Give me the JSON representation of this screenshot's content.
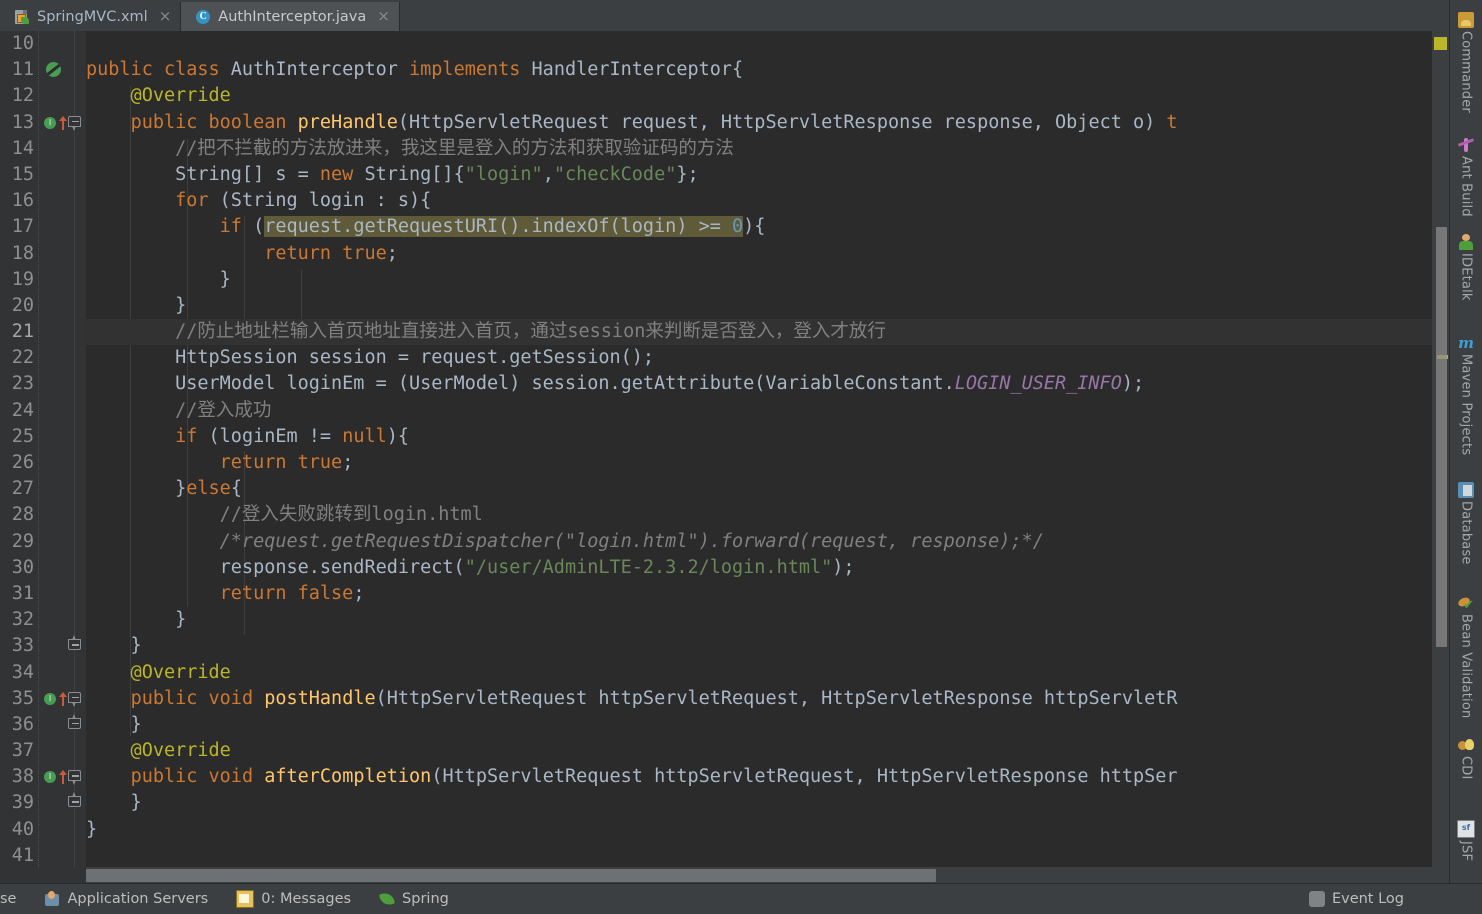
{
  "window": {
    "theme": "Darcula",
    "colors": {
      "editor_bg": "#2b2b2b",
      "gutter_bg": "#313335",
      "panel_bg": "#3c3f41",
      "active_tab_bg": "#4e5254",
      "text": "#a9b7c6",
      "keyword": "#cc7832",
      "string": "#6a8759",
      "comment": "#808080",
      "annotation": "#bbb529",
      "method": "#ffc66d",
      "number": "#6897bb",
      "static_field": "#9876aa",
      "selection": "#5f5a37",
      "current_line": "#323232",
      "marker_warning": "#bbb529"
    }
  },
  "tabs": [
    {
      "label": "SpringMVC.xml",
      "icon": "xml-file-icon",
      "active": false,
      "close": "×"
    },
    {
      "label": "AuthInterceptor.java",
      "icon": "java-class-icon",
      "active": true,
      "close": "×"
    }
  ],
  "editor": {
    "file": "AuthInterceptor.java",
    "first_visible_line": 10,
    "last_visible_line": 41,
    "current_line": 21,
    "lines": [
      {
        "n": "10",
        "tokens": []
      },
      {
        "n": "11",
        "marker": "run",
        "fold": null,
        "tokens": [
          {
            "t": "public ",
            "c": "kw"
          },
          {
            "t": "class ",
            "c": "kw"
          },
          {
            "t": "AuthInterceptor ",
            "c": "cls"
          },
          {
            "t": "implements ",
            "c": "kw"
          },
          {
            "t": "HandlerInterceptor{",
            "c": "plain"
          }
        ]
      },
      {
        "n": "12",
        "tokens": [
          {
            "t": "    @Override",
            "c": "ann"
          }
        ]
      },
      {
        "n": "13",
        "marker": "impl",
        "fold": "start",
        "tokens": [
          {
            "t": "    ",
            "c": "plain"
          },
          {
            "t": "public ",
            "c": "kw"
          },
          {
            "t": "boolean ",
            "c": "kw"
          },
          {
            "t": "preHandle",
            "c": "mth"
          },
          {
            "t": "(HttpServletRequest request, HttpServletResponse response, Object o) ",
            "c": "plain"
          },
          {
            "t": "t",
            "c": "kw"
          }
        ]
      },
      {
        "n": "14",
        "tokens": [
          {
            "t": "        //把不拦截的方法放进来，我这里是登入的方法和获取验证码的方法",
            "c": "cmt"
          }
        ]
      },
      {
        "n": "15",
        "tokens": [
          {
            "t": "        String[] s = ",
            "c": "plain"
          },
          {
            "t": "new ",
            "c": "kw"
          },
          {
            "t": "String[]{",
            "c": "plain"
          },
          {
            "t": "\"login\"",
            "c": "str"
          },
          {
            "t": ",",
            "c": "plain"
          },
          {
            "t": "\"checkCode\"",
            "c": "str"
          },
          {
            "t": "};",
            "c": "plain"
          }
        ]
      },
      {
        "n": "16",
        "tokens": [
          {
            "t": "        ",
            "c": "plain"
          },
          {
            "t": "for ",
            "c": "kw"
          },
          {
            "t": "(String login : s){",
            "c": "plain"
          }
        ]
      },
      {
        "n": "17",
        "tokens": [
          {
            "t": "            ",
            "c": "plain"
          },
          {
            "t": "if ",
            "c": "kw"
          },
          {
            "t": "(",
            "c": "plain"
          },
          {
            "t": "request.getRequestURI().indexOf(login) >= ",
            "c": "plain sel"
          },
          {
            "t": "0",
            "c": "num2 sel"
          },
          {
            "t": "){",
            "c": "plain"
          }
        ]
      },
      {
        "n": "18",
        "tokens": [
          {
            "t": "                ",
            "c": "plain"
          },
          {
            "t": "return ",
            "c": "kw"
          },
          {
            "t": "true",
            "c": "kw"
          },
          {
            "t": ";",
            "c": "plain"
          }
        ]
      },
      {
        "n": "19",
        "tokens": [
          {
            "t": "            }",
            "c": "plain"
          }
        ]
      },
      {
        "n": "20",
        "tokens": [
          {
            "t": "        }",
            "c": "plain"
          }
        ]
      },
      {
        "n": "21",
        "current": true,
        "tokens": [
          {
            "t": "        //防止地址栏输入首页地址直接进入首页，通过session来判断是否登入，登入才放行",
            "c": "cmt"
          }
        ]
      },
      {
        "n": "22",
        "tokens": [
          {
            "t": "        HttpSession session = request.getSession();",
            "c": "plain"
          }
        ]
      },
      {
        "n": "23",
        "tokens": [
          {
            "t": "        UserModel loginEm = (UserModel) session.getAttribute(VariableConstant.",
            "c": "plain"
          },
          {
            "t": "LOGIN_USER_INFO",
            "c": "stat"
          },
          {
            "t": ");",
            "c": "plain"
          }
        ]
      },
      {
        "n": "24",
        "tokens": [
          {
            "t": "        //登入成功",
            "c": "cmt"
          }
        ]
      },
      {
        "n": "25",
        "tokens": [
          {
            "t": "        ",
            "c": "plain"
          },
          {
            "t": "if ",
            "c": "kw"
          },
          {
            "t": "(loginEm != ",
            "c": "plain"
          },
          {
            "t": "null",
            "c": "kw"
          },
          {
            "t": "){",
            "c": "plain"
          }
        ]
      },
      {
        "n": "26",
        "tokens": [
          {
            "t": "            ",
            "c": "plain"
          },
          {
            "t": "return ",
            "c": "kw"
          },
          {
            "t": "true",
            "c": "kw"
          },
          {
            "t": ";",
            "c": "plain"
          }
        ]
      },
      {
        "n": "27",
        "tokens": [
          {
            "t": "        }",
            "c": "plain"
          },
          {
            "t": "else",
            "c": "kw"
          },
          {
            "t": "{",
            "c": "plain"
          }
        ]
      },
      {
        "n": "28",
        "tokens": [
          {
            "t": "            //登入失败跳转到login.html",
            "c": "cmt"
          }
        ]
      },
      {
        "n": "29",
        "tokens": [
          {
            "t": "            /*request.getRequestDispatcher(\"login.html\").forward(request, response);*/",
            "c": "cmt-i"
          }
        ]
      },
      {
        "n": "30",
        "tokens": [
          {
            "t": "            response.sendRedirect(",
            "c": "plain"
          },
          {
            "t": "\"/user/AdminLTE-2.3.2/login.html\"",
            "c": "str"
          },
          {
            "t": ");",
            "c": "plain"
          }
        ]
      },
      {
        "n": "31",
        "tokens": [
          {
            "t": "            ",
            "c": "plain"
          },
          {
            "t": "return ",
            "c": "kw"
          },
          {
            "t": "false",
            "c": "kw"
          },
          {
            "t": ";",
            "c": "plain"
          }
        ]
      },
      {
        "n": "32",
        "tokens": [
          {
            "t": "        }",
            "c": "plain"
          }
        ]
      },
      {
        "n": "33",
        "fold": "end",
        "tokens": [
          {
            "t": "    }",
            "c": "plain"
          }
        ]
      },
      {
        "n": "34",
        "tokens": [
          {
            "t": "    @Override",
            "c": "ann"
          }
        ]
      },
      {
        "n": "35",
        "marker": "impl",
        "fold": "start",
        "tokens": [
          {
            "t": "    ",
            "c": "plain"
          },
          {
            "t": "public ",
            "c": "kw"
          },
          {
            "t": "void ",
            "c": "kw"
          },
          {
            "t": "postHandle",
            "c": "mth"
          },
          {
            "t": "(HttpServletRequest httpServletRequest, HttpServletResponse httpServletR",
            "c": "plain"
          }
        ]
      },
      {
        "n": "36",
        "fold": "end",
        "tokens": [
          {
            "t": "    }",
            "c": "plain"
          }
        ]
      },
      {
        "n": "37",
        "tokens": [
          {
            "t": "    @Override",
            "c": "ann"
          }
        ]
      },
      {
        "n": "38",
        "marker": "impl",
        "fold": "start",
        "tokens": [
          {
            "t": "    ",
            "c": "plain"
          },
          {
            "t": "public ",
            "c": "kw"
          },
          {
            "t": "void ",
            "c": "kw"
          },
          {
            "t": "afterCompletion",
            "c": "mth"
          },
          {
            "t": "(HttpServletRequest httpServletRequest, HttpServletResponse httpSer",
            "c": "plain"
          }
        ]
      },
      {
        "n": "39",
        "fold": "end",
        "tokens": [
          {
            "t": "    }",
            "c": "plain"
          }
        ]
      },
      {
        "n": "40",
        "tokens": [
          {
            "t": "}",
            "c": "plain"
          }
        ]
      },
      {
        "n": "41",
        "tokens": []
      }
    ]
  },
  "right_toolbar": {
    "items": [
      {
        "label": "Commander",
        "icon": "commander-icon"
      },
      {
        "label": "Ant Build",
        "icon": "ant-build-icon"
      },
      {
        "label": "IDEtalk",
        "icon": "idetalk-icon"
      },
      {
        "label": "Maven Projects",
        "icon": "maven-icon"
      },
      {
        "label": "Database",
        "icon": "database-icon"
      },
      {
        "label": "Bean Validation",
        "icon": "bean-validation-icon"
      },
      {
        "label": "CDI",
        "icon": "cdi-icon"
      },
      {
        "label": "JSF",
        "icon": "jsf-icon"
      }
    ]
  },
  "statusbar": {
    "truncated_item": "se",
    "items": [
      {
        "label": "Application Servers",
        "icon": "application-servers-icon"
      },
      {
        "label": "0: Messages",
        "icon": "messages-icon",
        "mnemonic": "0"
      },
      {
        "label": "Spring",
        "icon": "spring-icon"
      }
    ],
    "event_log": {
      "label": "Event Log",
      "icon": "event-log-icon"
    }
  }
}
